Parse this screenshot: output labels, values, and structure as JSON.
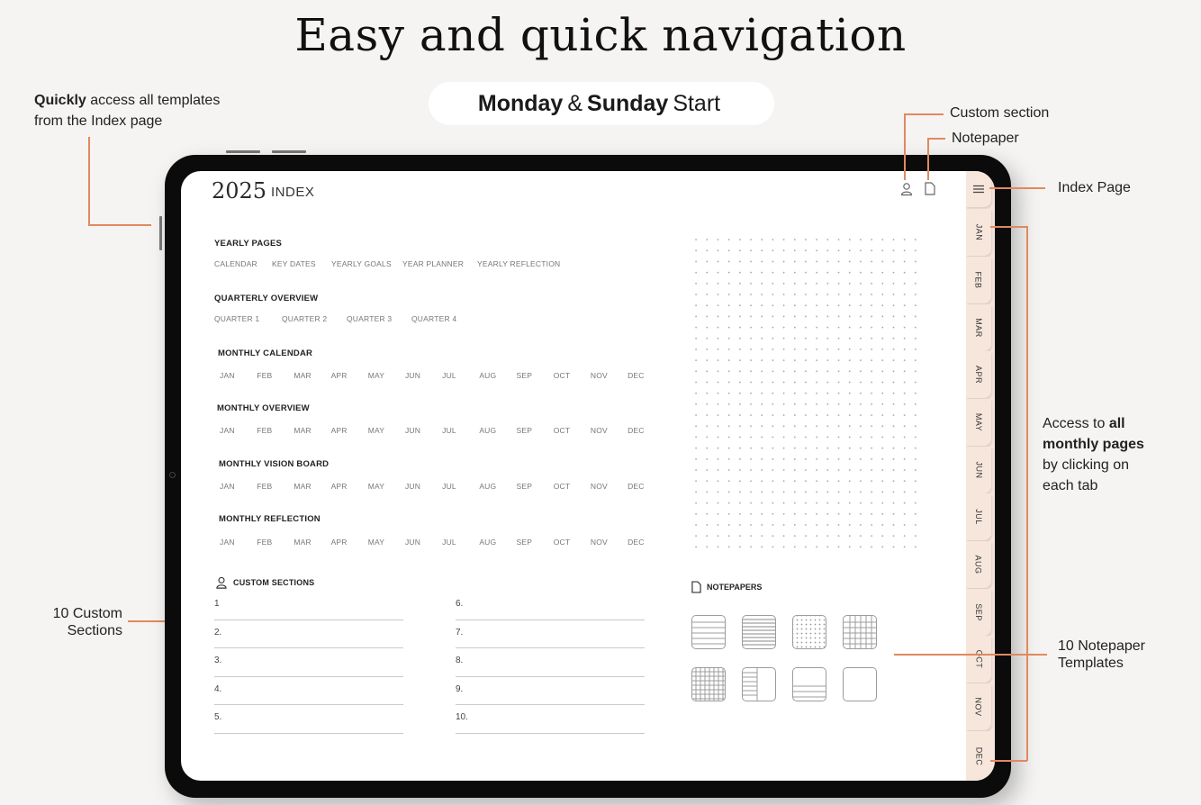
{
  "headline": "Easy and quick navigation",
  "pill": {
    "part1": "Monday",
    "amp": "&",
    "part2": "Sunday",
    "part3": "Start"
  },
  "annotations": {
    "quickly_bold": "Quickly",
    "quickly_rest": " access all templates",
    "quickly_line2": "from the Index page",
    "custom_section": "Custom section",
    "notepaper": "Notepaper",
    "index_page": "Index Page",
    "access_1": "Access to ",
    "access_bold_1": "all",
    "access_bold_2": "monthly pages",
    "access_3": "by clicking on",
    "access_4": "each tab",
    "custom_sections_1": "10 Custom",
    "custom_sections_2": "Sections",
    "notepaper_tpl_1": "10 Notepaper",
    "notepaper_tpl_2": "Templates"
  },
  "colors": {
    "accent": "#e0895f",
    "tab_bg": "#f6e6dc",
    "background": "#f5f4f2"
  },
  "planner": {
    "year": "2025",
    "title": "INDEX",
    "header_icons": [
      "user-icon",
      "document-icon"
    ],
    "yearly": {
      "title": "YEARLY PAGES",
      "items": [
        "CALENDAR",
        "KEY DATES",
        "YEARLY GOALS",
        "YEAR PLANNER",
        "YEARLY REFLECTION"
      ]
    },
    "quarterly": {
      "title": "QUARTERLY OVERVIEW",
      "items": [
        "QUARTER 1",
        "QUARTER 2",
        "QUARTER 3",
        "QUARTER 4"
      ]
    },
    "months": [
      "JAN",
      "FEB",
      "MAR",
      "APR",
      "MAY",
      "JUN",
      "JUL",
      "AUG",
      "SEP",
      "OCT",
      "NOV",
      "DEC"
    ],
    "monthly_sections": [
      "MONTHLY CALENDAR",
      "MONTHLY OVERVIEW",
      "MONTHLY VISION BOARD",
      "MONTHLY REFLECTION"
    ],
    "custom_sections": {
      "title": "CUSTOM SECTIONS",
      "items": [
        "1",
        "2.",
        "3.",
        "4.",
        "5.",
        "6.",
        "7.",
        "8.",
        "9.",
        "10."
      ]
    },
    "notepapers": {
      "title": "NOTEPAPERS",
      "templates": [
        "lined-wide",
        "lined-narrow",
        "dotted",
        "grid-large",
        "grid-small",
        "lined-left",
        "lined-bottom",
        "blank"
      ]
    },
    "tabs": {
      "menu_icon": "menu-icon",
      "months": [
        "JAN",
        "FEB",
        "MAR",
        "APR",
        "MAY",
        "JUN",
        "JUL",
        "AUG",
        "SEP",
        "OCT",
        "NOV",
        "DEC"
      ]
    }
  }
}
